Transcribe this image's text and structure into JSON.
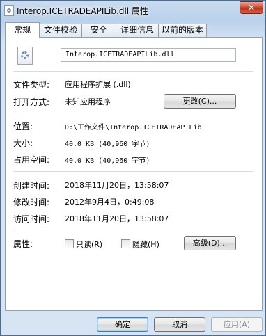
{
  "window": {
    "title": "Interop.ICETRADEAPILib.dll 属性",
    "close_glyph": "✕"
  },
  "tabs": [
    "常规",
    "文件校验",
    "安全",
    "详细信息",
    "以前的版本"
  ],
  "general": {
    "file_name": "Interop.ICETRADEAPILib.dll",
    "file_type_label": "文件类型:",
    "file_type_value": "应用程序扩展 (.dll)",
    "opens_with_label": "打开方式:",
    "opens_with_value": "未知应用程序",
    "change_button": "更改(C)...",
    "location_label": "位置:",
    "location_value": "D:\\工作文件\\Interop.ICETRADEAPILib",
    "size_label": "大小:",
    "size_value": "40.0 KB (40,960 字节)",
    "size_on_disk_label": "占用空间:",
    "size_on_disk_value": "40.0 KB (40,960 字节)",
    "created_label": "创建时间:",
    "created_value": "2018年11月20日，13:58:07",
    "modified_label": "修改时间:",
    "modified_value": "2012年9月4日，0:49:08",
    "accessed_label": "访问时间:",
    "accessed_value": "2018年11月20日，13:58:07",
    "attributes_label": "属性:",
    "readonly_label": "只读(R)",
    "hidden_label": "隐藏(H)",
    "advanced_button": "高级(D)..."
  },
  "footer": {
    "ok": "确定",
    "cancel": "取消",
    "apply": "应用(A)"
  },
  "icons": {
    "title_icon": "dll-file-icon",
    "file_icon": "dll-gear-file-icon"
  }
}
